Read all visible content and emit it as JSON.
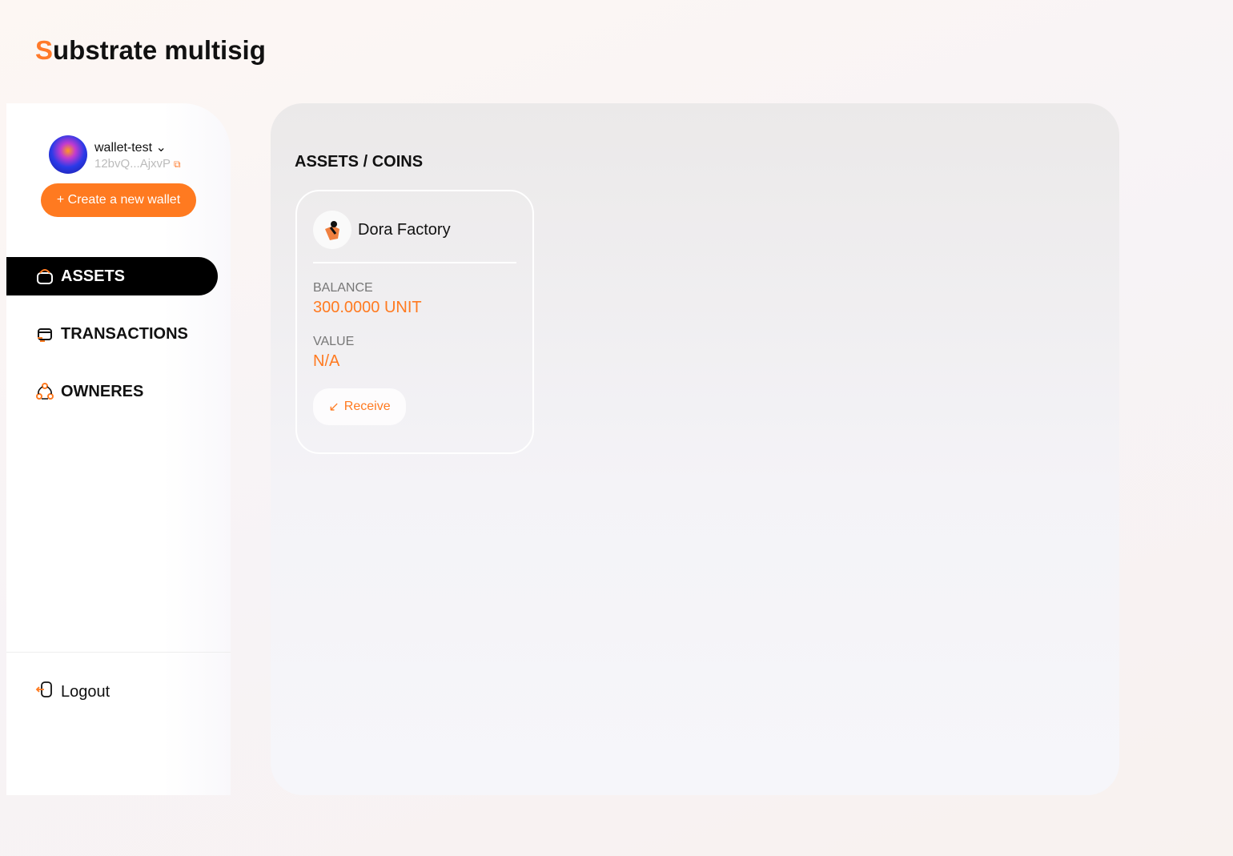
{
  "app": {
    "title_first": "S",
    "title_rest": "ubstrate multisig"
  },
  "wallet": {
    "name": "wallet-test",
    "address": "12bvQ...AjxvP",
    "create_label": "+ Create a new wallet"
  },
  "nav": [
    {
      "label": "ASSETS",
      "icon": "wallet-icon",
      "active": true
    },
    {
      "label": "TRANSACTIONS",
      "icon": "transactions-icon"
    },
    {
      "label": "OWNERES",
      "icon": "owners-icon"
    }
  ],
  "logout": "Logout",
  "main": {
    "breadcrumb": "ASSETS / COINS",
    "card": {
      "name": "Dora Factory",
      "balance_label": "BALANCE",
      "balance": "300.0000 UNIT",
      "value_label": "VALUE",
      "value": "N/A",
      "receive": "Receive"
    }
  },
  "colors": {
    "accent": "#ff7a20"
  }
}
